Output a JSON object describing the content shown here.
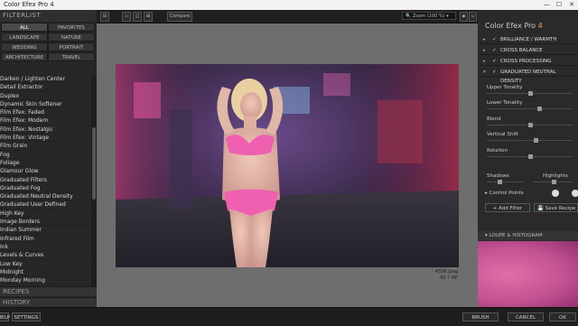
{
  "window": {
    "title": "Color Efex Pro 4"
  },
  "toolbar": {
    "compare_label": "Compare",
    "zoom_value": "Zoom (100 %)"
  },
  "left_panel": {
    "header": "FILTERLIST",
    "categories": [
      "ALL",
      "FAVORITES",
      "LANDSCAPE",
      "NATURE",
      "WEDDING",
      "PORTRAIT",
      "ARCHITECTURE",
      "TRAVEL"
    ],
    "filters": [
      "Darken / Lighten Center",
      "Detail Extractor",
      "Duplex",
      "Dynamic Skin Softener",
      "Film Efex: Faded",
      "Film Efex: Modern",
      "Film Efex: Nostalgic",
      "Film Efex: Vintage",
      "Film Grain",
      "Fog",
      "Foliage",
      "Glamour Glow",
      "Graduated Filters",
      "Graduated Fog",
      "Graduated Neutral Density",
      "Graduated User Defined",
      "High Key",
      "Image Borders",
      "Indian Summer",
      "Infrared Film",
      "Ink",
      "Levels & Curves",
      "Low Key",
      "Midnight",
      "Monday Morning"
    ],
    "recipes_label": "RECIPES",
    "history_label": "HISTORY",
    "help_label": "HELP",
    "settings_label": "SETTINGS"
  },
  "image": {
    "filename": "4336.jpeg",
    "size": "45.7 MP"
  },
  "right_panel": {
    "app_name": "Color Efex Pro",
    "app_version": "4",
    "filters": [
      "BRILLIANCE / WARMTH",
      "CROSS BALANCE",
      "CROSS PROCESSING",
      "GRADUATED NEUTRAL DENSITY"
    ],
    "params": {
      "upper_tonality": "Upper Tonality",
      "lower_tonality": "Lower Tonality",
      "blend": "Blend",
      "vertical_shift": "Vertical Shift",
      "rotation": "Rotation",
      "shadows": "Shadows",
      "highlights": "Highlights",
      "control_points": "Control Points"
    },
    "add_filter_label": "Add Filter",
    "save_recipe_label": "Save Recipe",
    "loupe_label": "LOUPE & HISTOGRAM"
  },
  "bottom": {
    "brush_label": "BRUSH",
    "cancel_label": "CANCEL",
    "ok_label": "OK"
  },
  "colors": {
    "accent": "#f0a030",
    "panel": "#2a2a2a",
    "canvas": "#6e6e6e"
  }
}
